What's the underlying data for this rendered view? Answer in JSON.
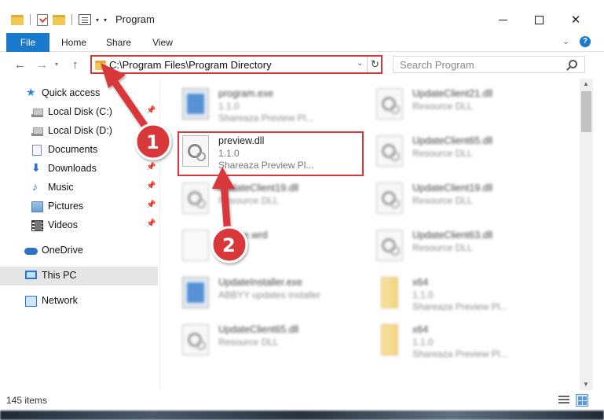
{
  "window": {
    "title": "Program",
    "minimize_icon": "minimize-icon",
    "maximize_icon": "maximize-icon",
    "close_label": "✕"
  },
  "ribbon": {
    "tabs": [
      {
        "label": "File"
      },
      {
        "label": "Home"
      },
      {
        "label": "Share"
      },
      {
        "label": "View"
      }
    ],
    "help_label": "?"
  },
  "address": {
    "path": "C:\\Program Files\\Program Directory"
  },
  "search": {
    "placeholder": "Search Program"
  },
  "sidebar": {
    "items": [
      {
        "label": "Quick access",
        "icon": "star-icon"
      },
      {
        "label": "Local Disk (C:)",
        "icon": "drive-icon",
        "pinned": true
      },
      {
        "label": "Local Disk (D:)",
        "icon": "drive-icon"
      },
      {
        "label": "Documents",
        "icon": "documents-icon",
        "pinned": true
      },
      {
        "label": "Downloads",
        "icon": "download-icon",
        "pinned": true
      },
      {
        "label": "Music",
        "icon": "music-icon",
        "pinned": true
      },
      {
        "label": "Pictures",
        "icon": "pictures-icon",
        "pinned": true
      },
      {
        "label": "Videos",
        "icon": "videos-icon",
        "pinned": true
      },
      {
        "label": "OneDrive",
        "icon": "onedrive-icon"
      },
      {
        "label": "This PC",
        "icon": "pc-icon",
        "selected": true
      },
      {
        "label": "Network",
        "icon": "network-icon"
      }
    ]
  },
  "files": {
    "left": [
      {
        "name": "program.exe",
        "line2": "1.1.0",
        "line3": "Shareaza Preview Pl...",
        "icon": "exe-icon"
      },
      {
        "name": "preview.dll",
        "line2": "1.1.0",
        "line3": "Shareaza Preview Pl...",
        "icon": "dll-icon",
        "highlighted": true
      },
      {
        "name": "UpdateClient19.dll",
        "line2": "Resource DLL",
        "line3": "",
        "icon": "dll-icon"
      },
      {
        "name": "license.wrd",
        "line2": "File",
        "line3": "",
        "icon": "blank-file-icon"
      },
      {
        "name": "UpdateInstaller.exe",
        "line2": "ABBYY updates installer",
        "line3": "",
        "icon": "exe-icon"
      },
      {
        "name": "UpdateClient65.dll",
        "line2": "Resource DLL",
        "line3": "",
        "icon": "dll-icon"
      }
    ],
    "right": [
      {
        "name": "UpdateClient21.dll",
        "line2": "Resource DLL",
        "line3": "",
        "icon": "dll-icon"
      },
      {
        "name": "UpdateClient65.dll",
        "line2": "Resource DLL",
        "line3": "",
        "icon": "dll-icon"
      },
      {
        "name": "UpdateClient19.dll",
        "line2": "Resource DLL",
        "line3": "",
        "icon": "dll-icon"
      },
      {
        "name": "UpdateClient63.dll",
        "line2": "Resource DLL",
        "line3": "",
        "icon": "dll-icon"
      },
      {
        "name": "x64",
        "line2": "1.1.0",
        "line3": "Shareaza Preview Pl...",
        "icon": "folder-icon"
      },
      {
        "name": "x64",
        "line2": "1.1.0",
        "line3": "Shareaza Preview Pl...",
        "icon": "folder-icon"
      }
    ]
  },
  "annotations": {
    "step1": "1",
    "step2": "2",
    "color": "#d9383b"
  },
  "status": {
    "item_count": "145 items"
  },
  "colors": {
    "accent": "#1979ca",
    "highlight": "#d9383b"
  }
}
